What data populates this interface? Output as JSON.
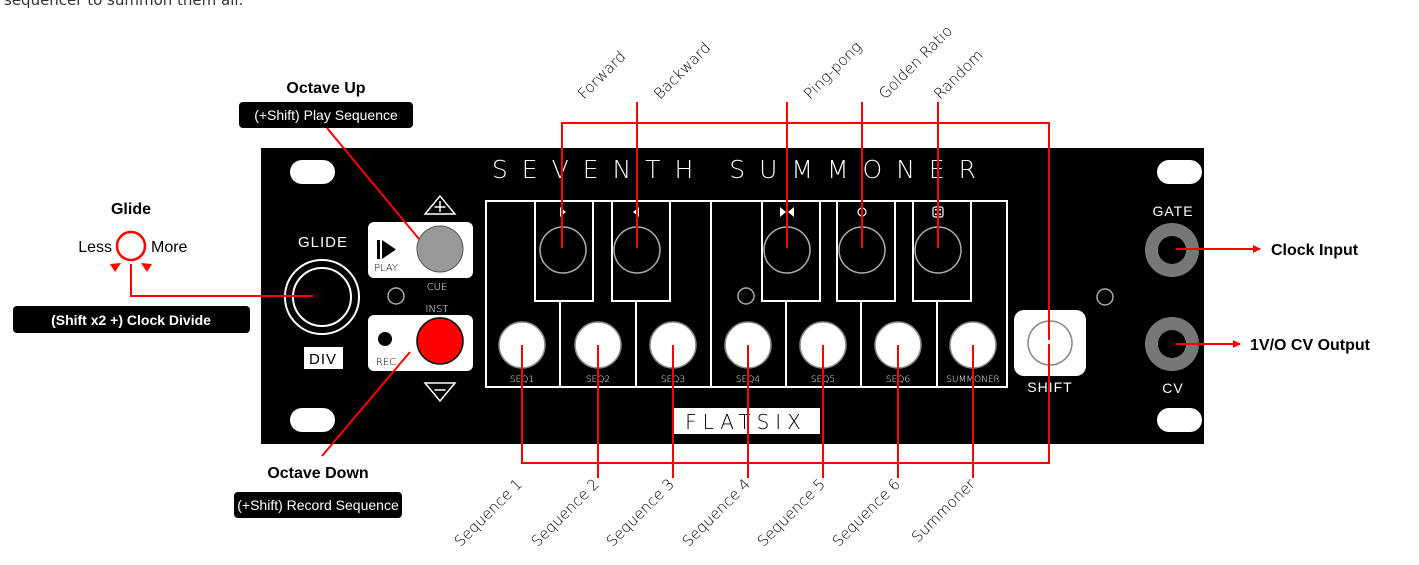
{
  "intro_text": "sequencer to summon them all.",
  "colors": {
    "panel": "#000000",
    "panel_text": "#ffffff",
    "callout_line": "#ff0000",
    "rec_button": "#ff0000",
    "cue_button": "#999999",
    "jack_ring": "#777777"
  },
  "panel": {
    "title": "SEVENTH SUMMONER",
    "brand": "FLATSIX",
    "glide_label": "GLIDE",
    "div_label": "DIV",
    "play_label": "PLAY",
    "cue_label": "CUE",
    "inst_label": "INST",
    "rec_label": "REC",
    "gate_label": "GATE",
    "cv_label": "CV",
    "shift_label": "SHIFT",
    "keys": [
      "SEQ1",
      "SEQ2",
      "SEQ3",
      "SEQ4",
      "SEQ5",
      "SEQ6",
      "SUMMONER"
    ],
    "mode_icons": [
      "play-forward-icon",
      "play-backward-icon",
      "ping-pong-icon",
      "golden-ratio-icon",
      "random-dice-icon"
    ]
  },
  "callouts": {
    "octave_up": "Octave Up",
    "play_sequence": "(+Shift) Play Sequence",
    "glide": "Glide",
    "less": "Less",
    "more": "More",
    "clock_divide": "(Shift x2 +) Clock Divide",
    "octave_down": "Octave Down",
    "record_sequence": "(+Shift) Record Sequence",
    "clock_input": "Clock Input",
    "cv_output": "1V/O CV Output",
    "modes": [
      "Forward",
      "Backward",
      "Ping-pong",
      "Golden Ratio",
      "Random"
    ],
    "sequences": [
      "Sequence 1",
      "Sequence 2",
      "Sequence 3",
      "Sequence 4",
      "Sequence 5",
      "Sequence 6",
      "Summoner"
    ]
  }
}
